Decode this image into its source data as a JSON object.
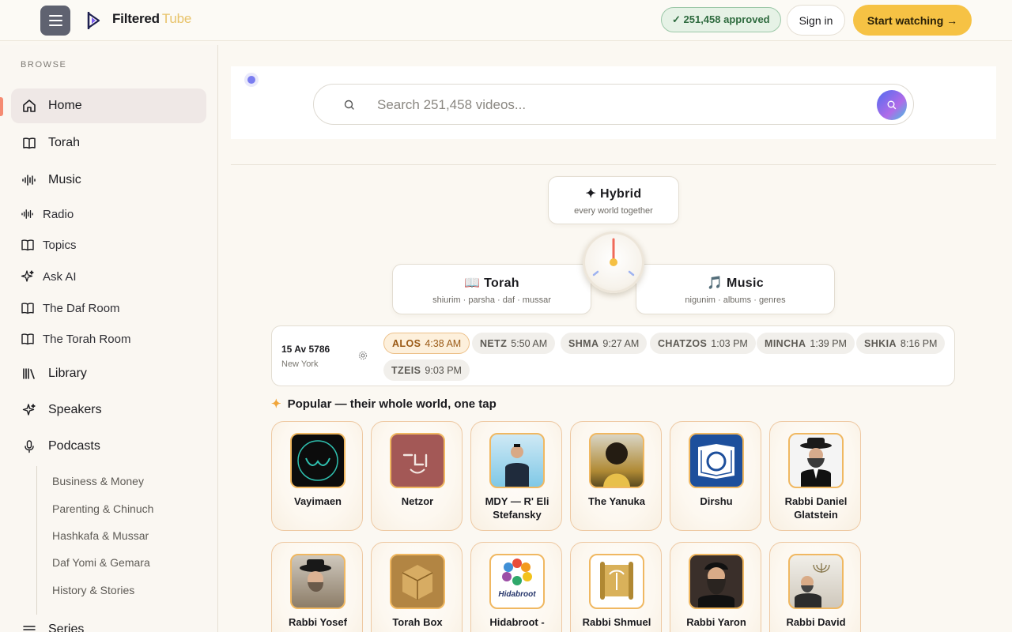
{
  "brand": {
    "name": "Filtered",
    "sub": "Tube"
  },
  "header": {
    "approved": "✓ 251,458 approved",
    "signin": "Sign in",
    "start": "Start watching →"
  },
  "sidebar": {
    "section": "BROWSE",
    "items": [
      {
        "label": "Home",
        "icon": "home-icon"
      },
      {
        "label": "Torah",
        "icon": "book-icon"
      },
      {
        "label": "Music",
        "icon": "waveform-icon"
      },
      {
        "label": "Radio",
        "icon": "waveform-icon"
      },
      {
        "label": "Topics",
        "icon": "book-icon"
      },
      {
        "label": "Ask AI",
        "icon": "sparkle-icon"
      },
      {
        "label": "The Daf Room",
        "icon": "book-icon"
      },
      {
        "label": "The Torah Room",
        "icon": "book-icon"
      },
      {
        "label": "Library",
        "icon": "library-icon"
      },
      {
        "label": "Speakers",
        "icon": "sparkle-icon"
      },
      {
        "label": "Podcasts",
        "icon": "microphone-icon"
      },
      {
        "label": "Series",
        "icon": "list-icon"
      }
    ],
    "podcast_subs": [
      "Business & Money",
      "Parenting & Chinuch",
      "Hashkafa & Mussar",
      "Daf Yomi & Gemara",
      "History & Stories"
    ]
  },
  "search": {
    "placeholder": "Search 251,458 videos..."
  },
  "modes": {
    "hybrid": {
      "title": "✦ Hybrid",
      "subtitle": "every world together"
    },
    "torah": {
      "title": "📖 Torah",
      "subtitle": "shiurim · parsha · daf · mussar"
    },
    "music": {
      "title": "🎵 Music",
      "subtitle": "nigunim · albums · genres"
    }
  },
  "zmanim": {
    "date": "15 Av 5786",
    "city": "New York",
    "times": [
      {
        "name": "ALOS",
        "time": "4:38 AM"
      },
      {
        "name": "NETZ",
        "time": "5:50 AM"
      },
      {
        "name": "SHMA",
        "time": "9:27 AM"
      },
      {
        "name": "CHATZOS",
        "time": "1:03 PM"
      },
      {
        "name": "MINCHA",
        "time": "1:39 PM"
      },
      {
        "name": "SHKIA",
        "time": "8:16 PM"
      },
      {
        "name": "TZEIS",
        "time": "9:03 PM"
      }
    ]
  },
  "popular": {
    "title": "Popular — their whole world, one tap",
    "channels": [
      {
        "name": "Vayimaen"
      },
      {
        "name": "Netzor"
      },
      {
        "name": "MDY — R' Eli Stefansky"
      },
      {
        "name": "The Yanuka"
      },
      {
        "name": "Dirshu"
      },
      {
        "name": "Rabbi Daniel Glatstein"
      },
      {
        "name": "Rabbi Yosef"
      },
      {
        "name": "Torah Box"
      },
      {
        "name": "Hidabroot -"
      },
      {
        "name": "Rabbi Shmuel"
      },
      {
        "name": "Rabbi Yaron"
      },
      {
        "name": "Rabbi David"
      }
    ]
  },
  "colors": {
    "accent": "#f6c244",
    "approved_bg": "#e6f2e6",
    "card_border": "#eec9a3"
  }
}
